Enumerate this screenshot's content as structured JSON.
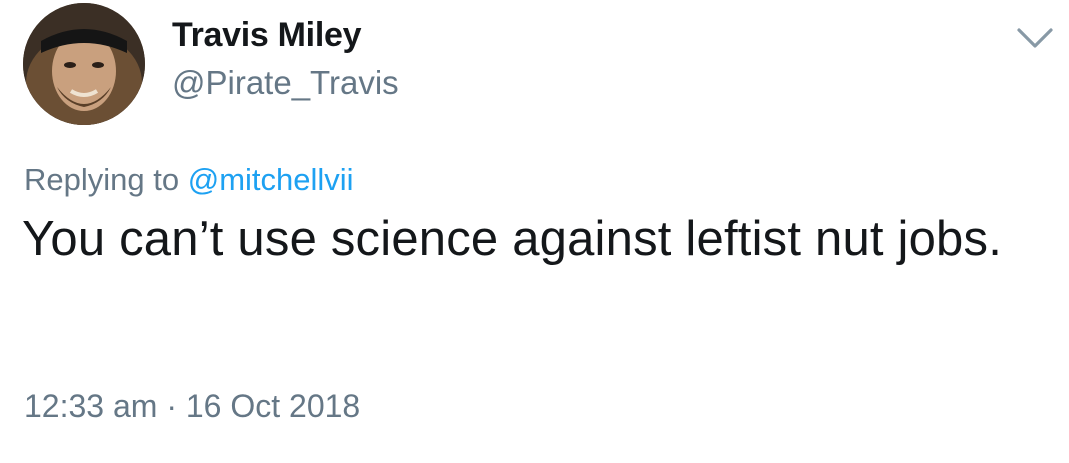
{
  "author": {
    "display_name": "Travis Miley",
    "handle": "@Pirate_Travis"
  },
  "reply": {
    "prefix": "Replying to",
    "mention": "@mitchellvii"
  },
  "tweet": {
    "text": "You can’t use science against leftist nut jobs."
  },
  "meta": {
    "timestamp": "12:33 am · 16 Oct 2018"
  },
  "icons": {
    "menu": "chevron-down-icon",
    "avatar": "avatar"
  },
  "colors": {
    "primary_text": "#14171a",
    "secondary_text": "#657786",
    "link": "#1da1f2",
    "background": "#ffffff"
  }
}
